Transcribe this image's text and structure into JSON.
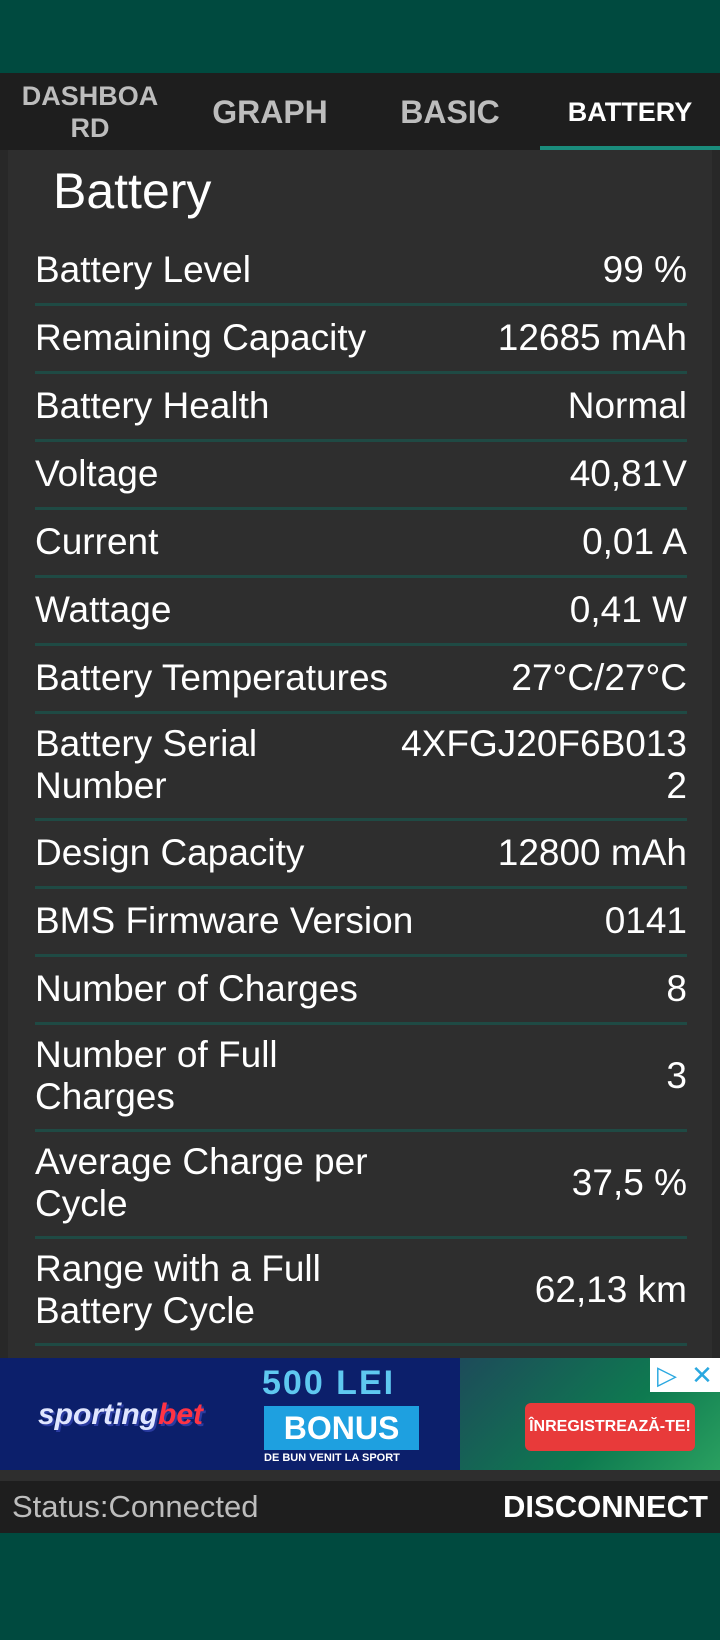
{
  "tabs": [
    {
      "label": "DASHBOARD"
    },
    {
      "label": "GRAPH"
    },
    {
      "label": "BASIC"
    },
    {
      "label": "BATTERY"
    }
  ],
  "active_tab": "BATTERY",
  "accent_color": "#1a8c7c",
  "title": "Battery",
  "rows": [
    {
      "label": "Battery Level",
      "value": "99 %"
    },
    {
      "label": "Remaining Capacity",
      "value": "12685 mAh"
    },
    {
      "label": "Battery Health",
      "value": "Normal"
    },
    {
      "label": "Voltage",
      "value": "40,81V"
    },
    {
      "label": "Current",
      "value": "0,01 A"
    },
    {
      "label": "Wattage",
      "value": "0,41 W"
    },
    {
      "label": "Battery Temperatures",
      "value": "27°C/27°C"
    },
    {
      "label": "Battery Serial Number",
      "value": "4XFGJ20F6B0132"
    },
    {
      "label": "Design Capacity",
      "value": "12800 mAh"
    },
    {
      "label": "BMS Firmware Version",
      "value": "0141"
    },
    {
      "label": "Number of Charges",
      "value": "8"
    },
    {
      "label": "Number of Full Charges",
      "value": "3"
    },
    {
      "label": "Average Charge per Cycle",
      "value": "37,5 %"
    },
    {
      "label": "Range with a Full Battery Cycle",
      "value": "62,13 km"
    }
  ],
  "ad": {
    "brand_a": "sporting",
    "brand_b": "bet",
    "headline": "500 LEI",
    "bonus": "BONUS",
    "sub": "DE BUN VENIT LA SPORT",
    "cta": "ÎNREGISTREAZĂ-TE!",
    "adchoices_icon": "adchoices-icon",
    "close_icon": "close-icon"
  },
  "status": {
    "text": "Status:Connected",
    "button": "DISCONNECT"
  }
}
